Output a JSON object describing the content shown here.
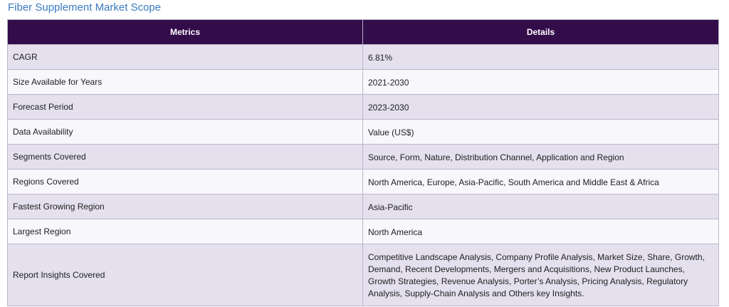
{
  "page": {
    "title": "Fiber Supplement Market Scope"
  },
  "table": {
    "headers": {
      "metric": "Metrics",
      "details": "Details"
    },
    "rows": [
      {
        "metric": "CAGR",
        "details": "6.81%"
      },
      {
        "metric": "Size Available for Years",
        "details": "2021-2030"
      },
      {
        "metric": "Forecast Period",
        "details": "2023-2030"
      },
      {
        "metric": "Data Availability",
        "details": "Value (US$)"
      },
      {
        "metric": "Segments Covered",
        "details": "Source, Form, Nature, Distribution Channel, Application and Region"
      },
      {
        "metric": "Regions Covered",
        "details": "North America, Europe, Asia-Pacific, South America and Middle East & Africa"
      },
      {
        "metric": "Fastest Growing Region",
        "details": "Asia-Pacific"
      },
      {
        "metric": "Largest Region",
        "details": "North America"
      },
      {
        "metric": "Report Insights Covered",
        "details": "Competitive Landscape Analysis, Company Profile Analysis, Market Size, Share, Growth, Demand, Recent Developments, Mergers and Acquisitions, New Product Launches, Growth Strategies, Revenue Analysis, Porter’s Analysis, Pricing Analysis, Regulatory Analysis, Supply-Chain Analysis and Others key Insights."
      }
    ]
  },
  "colors": {
    "header_bg": "#330c4a",
    "title_text": "#3a7abf",
    "row_shaded": "#e4e0ee",
    "row_light": "#f8f7fb"
  }
}
